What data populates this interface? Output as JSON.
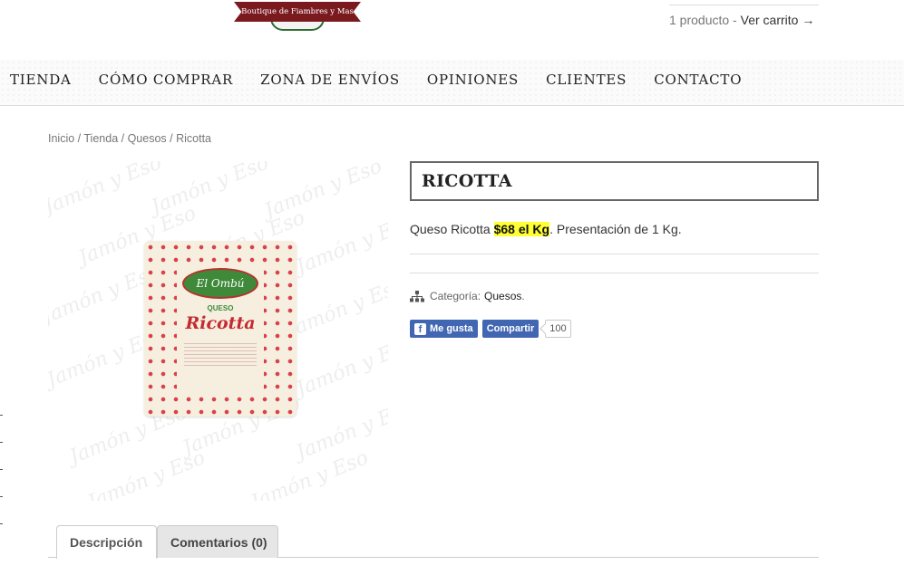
{
  "header": {
    "logo_text": "Boutique de Fiambres y Mas",
    "cart_count": "1 producto",
    "cart_separator": " - ",
    "cart_link": "Ver carrito →"
  },
  "nav": {
    "items": [
      "TIENDA",
      "CÓMO COMPRAR",
      "ZONA DE ENVÍOS",
      "OPINIONES",
      "CLIENTES",
      "CONTACTO"
    ]
  },
  "breadcrumb": {
    "items": [
      "Inicio",
      "Tienda",
      "Quesos",
      "Ricotta"
    ],
    "separator": " / "
  },
  "product": {
    "title": "RICOTTA",
    "desc_prefix": "Queso Ricotta ",
    "price_highlight": "$68 el Kg",
    "desc_suffix": ". Presentación de 1 Kg.",
    "image": {
      "watermark": "Jamón y Eso",
      "brand": "El Ombú",
      "kind": "QUESO",
      "name": "Ricotta"
    },
    "category_label": "Categoría:",
    "category_value": "Quesos",
    "category_end": "."
  },
  "social": {
    "like_label": "Me gusta",
    "share_label": "Compartir",
    "count": "100"
  },
  "tabs": {
    "description": "Descripción",
    "comments": "Comentarios (0)"
  },
  "colors": {
    "price_highlight": "#ffff33",
    "facebook": "#4267b2"
  }
}
